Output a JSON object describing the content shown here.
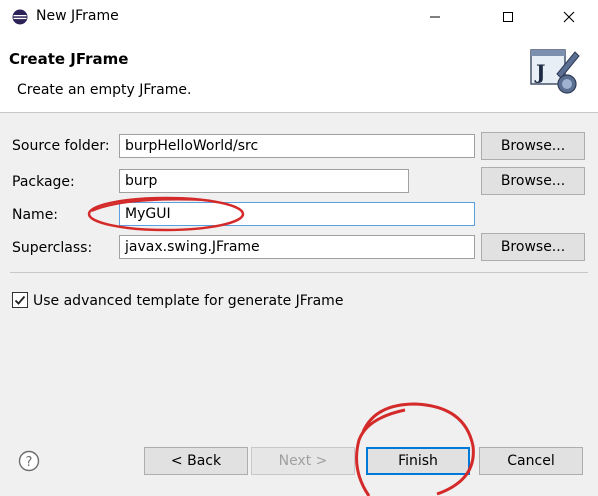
{
  "window": {
    "title": "New JFrame"
  },
  "header": {
    "title": "Create JFrame",
    "description": "Create an empty JFrame."
  },
  "form": {
    "source_folder": {
      "label": "Source folder:",
      "value": "burpHelloWorld/src",
      "browse": "Browse..."
    },
    "package": {
      "label": "Package:",
      "value": "burp",
      "browse": "Browse..."
    },
    "name": {
      "label": "Name:",
      "value": "MyGUI"
    },
    "superclass": {
      "label": "Superclass:",
      "value": "javax.swing.JFrame",
      "browse": "Browse..."
    },
    "advanced_template": {
      "label": "Use advanced template for generate JFrame",
      "checked": true
    }
  },
  "footer": {
    "help": "?",
    "back": "< Back",
    "next": "Next >",
    "finish": "Finish",
    "cancel": "Cancel"
  },
  "colors": {
    "annotation": "#d42a2a",
    "accent": "#0078d7"
  },
  "icons": [
    "eclipse-icon",
    "minimize-icon",
    "maximize-icon",
    "close-icon",
    "jframe-wizard-icon",
    "help-icon",
    "checkmark-icon"
  ]
}
